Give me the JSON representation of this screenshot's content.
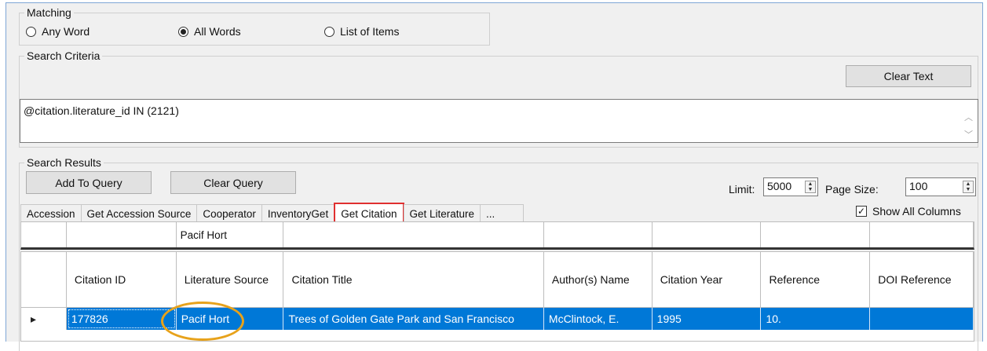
{
  "matching": {
    "title": "Matching",
    "options": [
      {
        "label": "Any Word",
        "selected": false
      },
      {
        "label": "All Words",
        "selected": true
      },
      {
        "label": "List of Items",
        "selected": false
      }
    ]
  },
  "search_criteria": {
    "title": "Search Criteria",
    "clear_text_label": "Clear Text",
    "query_text": "@citation.literature_id IN (2121)",
    "scroll_up_icon": "chevron-up-icon",
    "scroll_down_icon": "chevron-down-icon"
  },
  "search_results": {
    "title": "Search Results",
    "add_to_query_label": "Add To Query",
    "clear_query_label": "Clear Query",
    "limit_label": "Limit:",
    "limit_value": "5000",
    "page_size_label": "Page Size:",
    "page_size_value": "100",
    "show_all_columns_label": "Show All Columns",
    "show_all_columns_checked": true,
    "tabs": [
      {
        "label": "Accession"
      },
      {
        "label": "Get Accession Source"
      },
      {
        "label": "Cooperator"
      },
      {
        "label": "InventoryGet"
      },
      {
        "label": "Get Citation",
        "active": true
      },
      {
        "label": "Get Literature"
      },
      {
        "label": "..."
      }
    ],
    "filter_row": [
      "",
      "",
      "Pacif Hort",
      "",
      "",
      "",
      "",
      ""
    ],
    "columns": [
      "",
      "Citation ID",
      "Literature Source",
      "Citation Title",
      "Author(s) Name",
      "Citation Year",
      "Reference",
      "DOI Reference"
    ],
    "rows": [
      {
        "indicator": "▸",
        "cells": [
          "177826",
          "Pacif Hort",
          "Trees of Golden Gate Park and San Francisco",
          "McClintock, E.",
          "1995",
          "10.",
          ""
        ]
      }
    ]
  },
  "colors": {
    "selection": "#0078d7",
    "active_tab_highlight": "#e03030",
    "annotation_circle": "#e7a21b"
  }
}
